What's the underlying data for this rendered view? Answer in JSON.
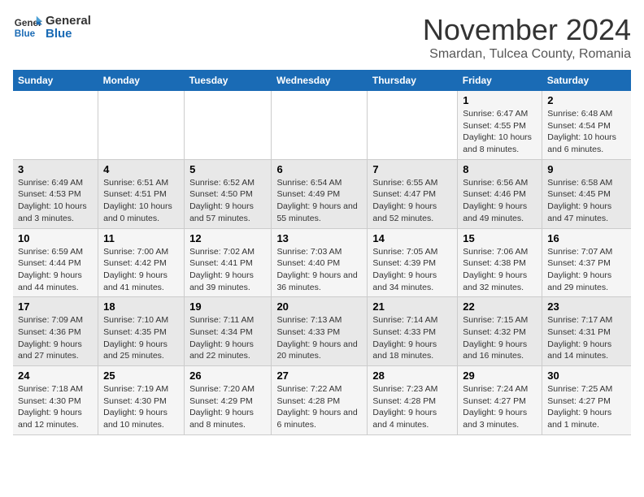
{
  "logo": {
    "line1": "General",
    "line2": "Blue"
  },
  "title": "November 2024",
  "subtitle": "Smardan, Tulcea County, Romania",
  "days_of_week": [
    "Sunday",
    "Monday",
    "Tuesday",
    "Wednesday",
    "Thursday",
    "Friday",
    "Saturday"
  ],
  "weeks": [
    [
      {
        "num": "",
        "info": ""
      },
      {
        "num": "",
        "info": ""
      },
      {
        "num": "",
        "info": ""
      },
      {
        "num": "",
        "info": ""
      },
      {
        "num": "",
        "info": ""
      },
      {
        "num": "1",
        "info": "Sunrise: 6:47 AM\nSunset: 4:55 PM\nDaylight: 10 hours and 8 minutes."
      },
      {
        "num": "2",
        "info": "Sunrise: 6:48 AM\nSunset: 4:54 PM\nDaylight: 10 hours and 6 minutes."
      }
    ],
    [
      {
        "num": "3",
        "info": "Sunrise: 6:49 AM\nSunset: 4:53 PM\nDaylight: 10 hours and 3 minutes."
      },
      {
        "num": "4",
        "info": "Sunrise: 6:51 AM\nSunset: 4:51 PM\nDaylight: 10 hours and 0 minutes."
      },
      {
        "num": "5",
        "info": "Sunrise: 6:52 AM\nSunset: 4:50 PM\nDaylight: 9 hours and 57 minutes."
      },
      {
        "num": "6",
        "info": "Sunrise: 6:54 AM\nSunset: 4:49 PM\nDaylight: 9 hours and 55 minutes."
      },
      {
        "num": "7",
        "info": "Sunrise: 6:55 AM\nSunset: 4:47 PM\nDaylight: 9 hours and 52 minutes."
      },
      {
        "num": "8",
        "info": "Sunrise: 6:56 AM\nSunset: 4:46 PM\nDaylight: 9 hours and 49 minutes."
      },
      {
        "num": "9",
        "info": "Sunrise: 6:58 AM\nSunset: 4:45 PM\nDaylight: 9 hours and 47 minutes."
      }
    ],
    [
      {
        "num": "10",
        "info": "Sunrise: 6:59 AM\nSunset: 4:44 PM\nDaylight: 9 hours and 44 minutes."
      },
      {
        "num": "11",
        "info": "Sunrise: 7:00 AM\nSunset: 4:42 PM\nDaylight: 9 hours and 41 minutes."
      },
      {
        "num": "12",
        "info": "Sunrise: 7:02 AM\nSunset: 4:41 PM\nDaylight: 9 hours and 39 minutes."
      },
      {
        "num": "13",
        "info": "Sunrise: 7:03 AM\nSunset: 4:40 PM\nDaylight: 9 hours and 36 minutes."
      },
      {
        "num": "14",
        "info": "Sunrise: 7:05 AM\nSunset: 4:39 PM\nDaylight: 9 hours and 34 minutes."
      },
      {
        "num": "15",
        "info": "Sunrise: 7:06 AM\nSunset: 4:38 PM\nDaylight: 9 hours and 32 minutes."
      },
      {
        "num": "16",
        "info": "Sunrise: 7:07 AM\nSunset: 4:37 PM\nDaylight: 9 hours and 29 minutes."
      }
    ],
    [
      {
        "num": "17",
        "info": "Sunrise: 7:09 AM\nSunset: 4:36 PM\nDaylight: 9 hours and 27 minutes."
      },
      {
        "num": "18",
        "info": "Sunrise: 7:10 AM\nSunset: 4:35 PM\nDaylight: 9 hours and 25 minutes."
      },
      {
        "num": "19",
        "info": "Sunrise: 7:11 AM\nSunset: 4:34 PM\nDaylight: 9 hours and 22 minutes."
      },
      {
        "num": "20",
        "info": "Sunrise: 7:13 AM\nSunset: 4:33 PM\nDaylight: 9 hours and 20 minutes."
      },
      {
        "num": "21",
        "info": "Sunrise: 7:14 AM\nSunset: 4:33 PM\nDaylight: 9 hours and 18 minutes."
      },
      {
        "num": "22",
        "info": "Sunrise: 7:15 AM\nSunset: 4:32 PM\nDaylight: 9 hours and 16 minutes."
      },
      {
        "num": "23",
        "info": "Sunrise: 7:17 AM\nSunset: 4:31 PM\nDaylight: 9 hours and 14 minutes."
      }
    ],
    [
      {
        "num": "24",
        "info": "Sunrise: 7:18 AM\nSunset: 4:30 PM\nDaylight: 9 hours and 12 minutes."
      },
      {
        "num": "25",
        "info": "Sunrise: 7:19 AM\nSunset: 4:30 PM\nDaylight: 9 hours and 10 minutes."
      },
      {
        "num": "26",
        "info": "Sunrise: 7:20 AM\nSunset: 4:29 PM\nDaylight: 9 hours and 8 minutes."
      },
      {
        "num": "27",
        "info": "Sunrise: 7:22 AM\nSunset: 4:28 PM\nDaylight: 9 hours and 6 minutes."
      },
      {
        "num": "28",
        "info": "Sunrise: 7:23 AM\nSunset: 4:28 PM\nDaylight: 9 hours and 4 minutes."
      },
      {
        "num": "29",
        "info": "Sunrise: 7:24 AM\nSunset: 4:27 PM\nDaylight: 9 hours and 3 minutes."
      },
      {
        "num": "30",
        "info": "Sunrise: 7:25 AM\nSunset: 4:27 PM\nDaylight: 9 hours and 1 minute."
      }
    ]
  ]
}
